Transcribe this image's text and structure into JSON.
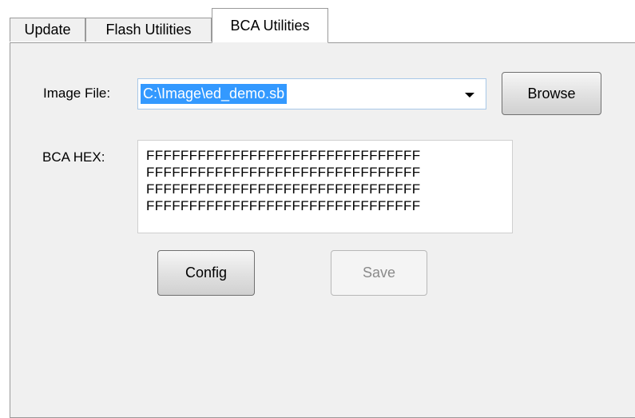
{
  "tabs": [
    {
      "label": "Update"
    },
    {
      "label": "Flash Utilities"
    },
    {
      "label": "BCA Utilities"
    }
  ],
  "active_tab": "BCA Utilities",
  "image_file": {
    "label": "Image File:",
    "value": "C:\\Image\\ed_demo.sb"
  },
  "browse_button": {
    "label": "Browse"
  },
  "bca_hex": {
    "label": "BCA HEX:",
    "lines": [
      "FFFFFFFFFFFFFFFFFFFFFFFFFFFFFFFF",
      "FFFFFFFFFFFFFFFFFFFFFFFFFFFFFFFF",
      "FFFFFFFFFFFFFFFFFFFFFFFFFFFFFFFF",
      "FFFFFFFFFFFFFFFFFFFFFFFFFFFFFFFF"
    ]
  },
  "config_button": {
    "label": "Config"
  },
  "save_button": {
    "label": "Save",
    "enabled": false
  },
  "colors": {
    "selection": "#3399ff",
    "panel_bg": "#f0f0f0",
    "disabled_text": "#8a8a8a"
  },
  "icons": {
    "dropdown": "chevron-down-icon"
  }
}
